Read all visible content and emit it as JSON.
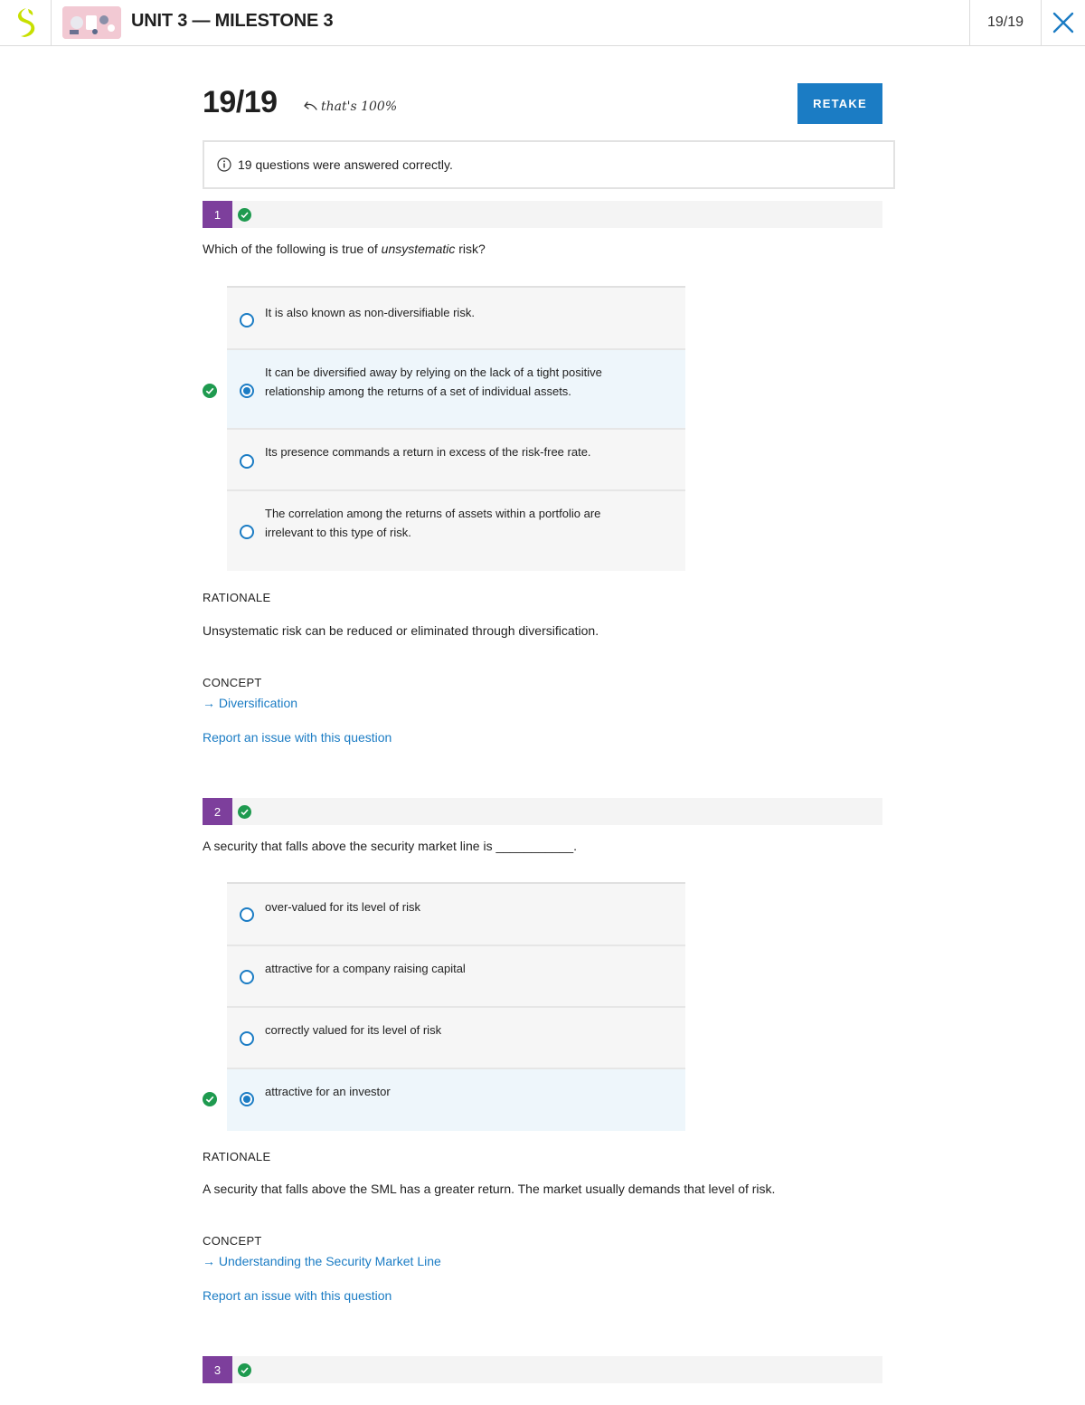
{
  "topbar": {
    "unit_title": "UNIT 3 — MILESTONE 3",
    "score": "19/19",
    "icons": {
      "logo": "sophia-logo-icon",
      "close": "close-icon"
    }
  },
  "header": {
    "score": "19/19",
    "thats": "that's 100%",
    "retake_label": "RETAKE",
    "info_text": "19 questions were answered correctly."
  },
  "colors": {
    "accent": "#1b7cc4",
    "badge": "#7d3f9c",
    "correct": "#1e9a4f",
    "logo": "#c8e000"
  },
  "questions": [
    {
      "number": "1",
      "text_before": "Which of the following is true of ",
      "text_emphasis": "unsystematic",
      "text_after": " risk?",
      "options": [
        "It is also known as non-diversifiable risk.",
        "It can be diversified away by relying on the lack of a tight positive relationship among the returns of a set of individual assets.",
        "Its presence commands a return in excess of the risk-free rate.",
        "The correlation among the returns of assets within a portfolio are irrelevant to this type of risk."
      ],
      "selected_index": 1,
      "rationale_label": "RATIONALE",
      "rationale": "Unsystematic risk can be reduced or eliminated through diversification.",
      "concept_label": "CONCEPT",
      "concept": "→ Diversification",
      "report": "Report an issue with this question"
    },
    {
      "number": "2",
      "text": "A security that falls above the security market line is ___________.",
      "options": [
        "over-valued for its level of risk",
        "attractive for a company raising capital",
        "correctly valued for its level of risk",
        "attractive for an investor"
      ],
      "selected_index": 3,
      "rationale_label": "RATIONALE",
      "rationale": "A security that falls above the SML has a greater return. The market usually demands that level of risk.",
      "concept_label": "CONCEPT",
      "concept": "→ Understanding the Security Market Line",
      "report": "Report an issue with this question"
    },
    {
      "number": "3"
    }
  ]
}
